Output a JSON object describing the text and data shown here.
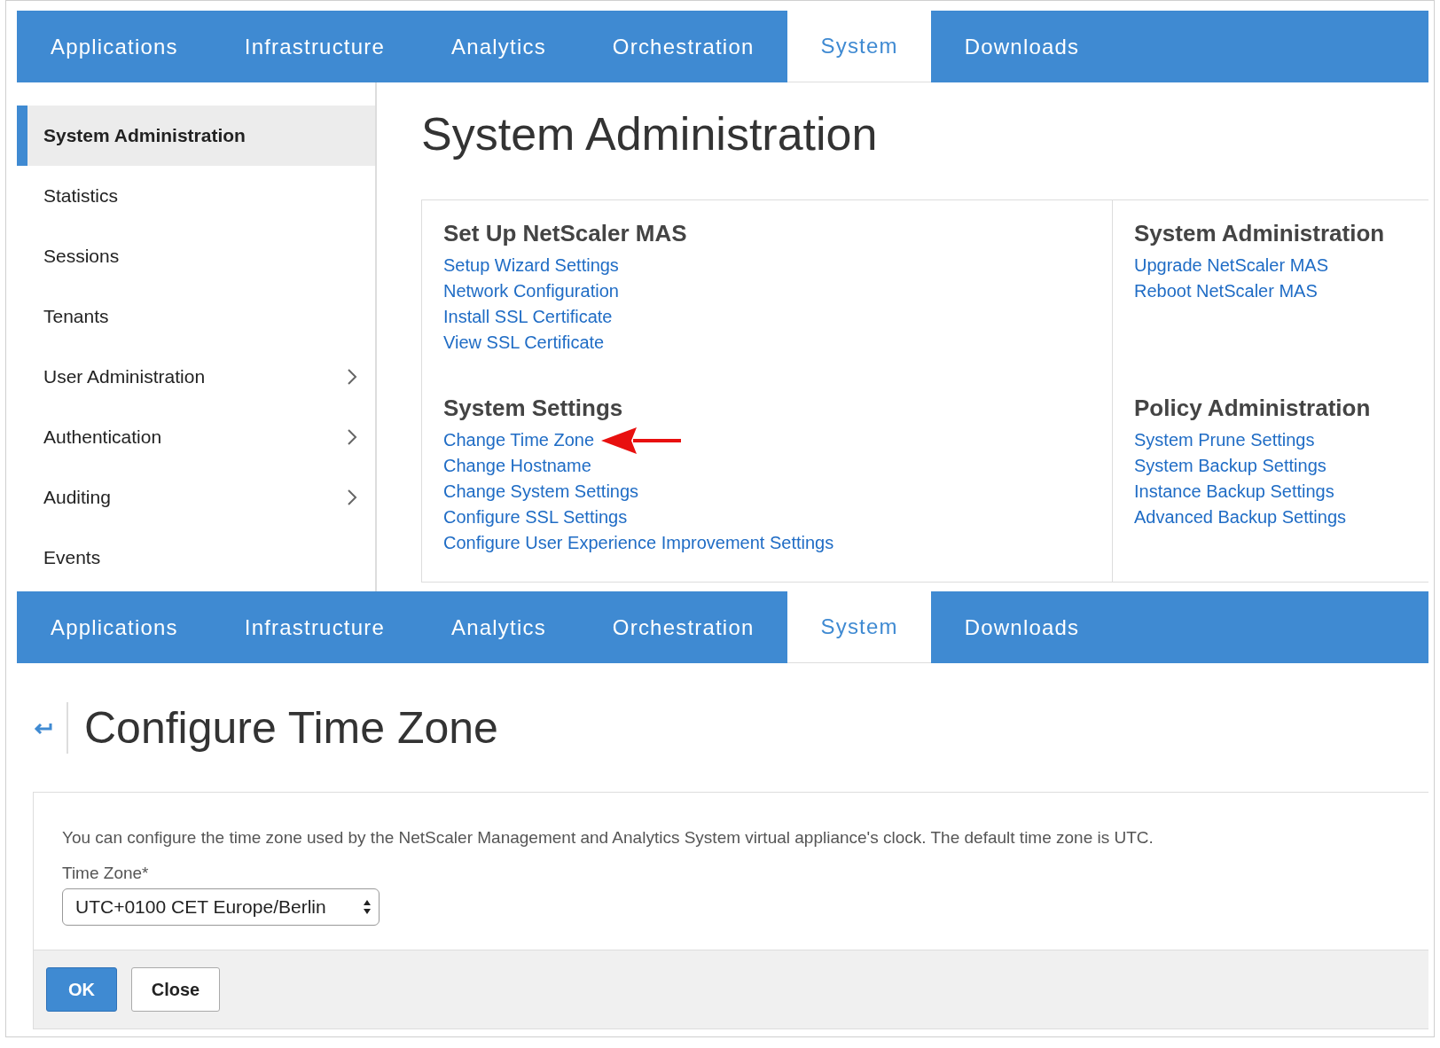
{
  "top_nav": {
    "tabs": [
      {
        "label": "Applications",
        "selected": false
      },
      {
        "label": "Infrastructure",
        "selected": false
      },
      {
        "label": "Analytics",
        "selected": false
      },
      {
        "label": "Orchestration",
        "selected": false
      },
      {
        "label": "System",
        "selected": true
      },
      {
        "label": "Downloads",
        "selected": false
      }
    ]
  },
  "sidebar": {
    "items": [
      {
        "label": "System Administration",
        "selected": true,
        "expandable": false
      },
      {
        "label": "Statistics",
        "selected": false,
        "expandable": false
      },
      {
        "label": "Sessions",
        "selected": false,
        "expandable": false
      },
      {
        "label": "Tenants",
        "selected": false,
        "expandable": false
      },
      {
        "label": "User Administration",
        "selected": false,
        "expandable": true
      },
      {
        "label": "Authentication",
        "selected": false,
        "expandable": true
      },
      {
        "label": "Auditing",
        "selected": false,
        "expandable": true
      },
      {
        "label": "Events",
        "selected": false,
        "expandable": false
      }
    ]
  },
  "admin_page": {
    "title": "System Administration",
    "columns": [
      {
        "sections": [
          {
            "heading": "Set Up NetScaler MAS",
            "links": [
              {
                "label": "Setup Wizard Settings",
                "annotated": false
              },
              {
                "label": "Network Configuration",
                "annotated": false
              },
              {
                "label": "Install SSL Certificate",
                "annotated": false
              },
              {
                "label": "View SSL Certificate",
                "annotated": false
              }
            ]
          },
          {
            "heading": "System Settings",
            "links": [
              {
                "label": "Change Time Zone",
                "annotated": true
              },
              {
                "label": "Change Hostname",
                "annotated": false
              },
              {
                "label": "Change System Settings",
                "annotated": false
              },
              {
                "label": "Configure SSL Settings",
                "annotated": false
              },
              {
                "label": "Configure User Experience Improvement Settings",
                "annotated": false
              }
            ]
          }
        ]
      },
      {
        "sections": [
          {
            "heading": "System Administration",
            "links": [
              {
                "label": "Upgrade NetScaler MAS",
                "annotated": false
              },
              {
                "label": "Reboot NetScaler MAS",
                "annotated": false
              }
            ]
          },
          {
            "heading": "Policy Administration",
            "links": [
              {
                "label": "System Prune Settings",
                "annotated": false
              },
              {
                "label": "System Backup Settings",
                "annotated": false
              },
              {
                "label": "Instance Backup Settings",
                "annotated": false
              },
              {
                "label": "Advanced Backup Settings",
                "annotated": false
              }
            ]
          }
        ]
      }
    ]
  },
  "bottom_nav": {
    "tabs": [
      {
        "label": "Applications",
        "selected": false
      },
      {
        "label": "Infrastructure",
        "selected": false
      },
      {
        "label": "Analytics",
        "selected": false
      },
      {
        "label": "Orchestration",
        "selected": false
      },
      {
        "label": "System",
        "selected": true
      },
      {
        "label": "Downloads",
        "selected": false
      }
    ]
  },
  "config_page": {
    "title": "Configure Time Zone",
    "description": "You can configure the time zone used by the NetScaler Management and Analytics System virtual appliance's clock. The default time zone is UTC.",
    "field": {
      "label": "Time Zone*",
      "value": "UTC+0100 CET Europe/Berlin"
    },
    "buttons": [
      {
        "label": "OK",
        "kind": "primary"
      },
      {
        "label": "Close",
        "kind": "secondary"
      }
    ]
  }
}
